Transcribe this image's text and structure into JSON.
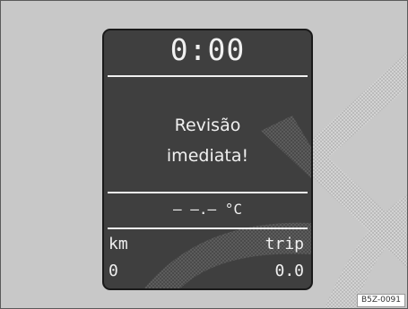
{
  "display": {
    "time": "0:00",
    "message_line1": "Revisão",
    "message_line2": "imediata!",
    "temperature": "— —.— °C",
    "odometer": {
      "km_label": "km",
      "km_value": "0",
      "trip_label": "trip",
      "trip_value": "0.0"
    }
  },
  "figure_code": "B5Z-0091",
  "colors": {
    "page_background": "#c8c8c8",
    "display_background": "#3f3f3f",
    "display_text": "#f0f0f0"
  }
}
